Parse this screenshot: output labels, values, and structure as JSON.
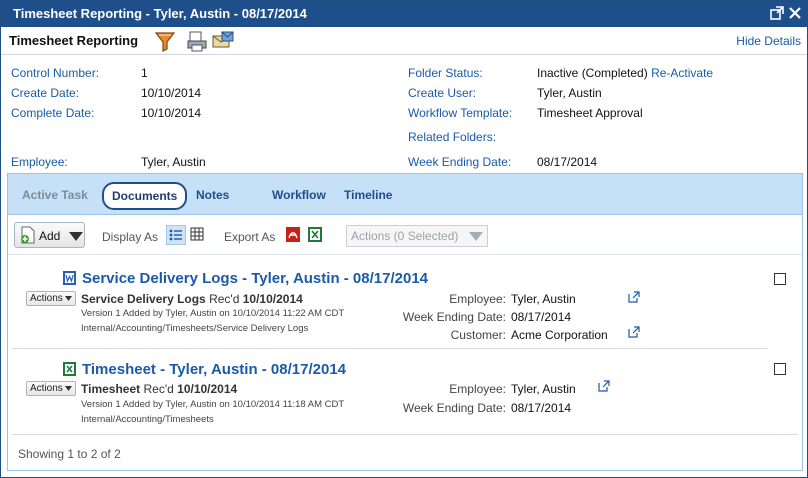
{
  "window": {
    "title": "Timesheet Reporting - Tyler, Austin - 08/17/2014"
  },
  "toolbar": {
    "title": "Timesheet Reporting",
    "hide_details": "Hide Details"
  },
  "details": {
    "control_number_label": "Control Number:",
    "control_number": "1",
    "create_date_label": "Create Date:",
    "create_date": "10/10/2014",
    "complete_date_label": "Complete Date:",
    "complete_date": "10/10/2014",
    "folder_status_label": "Folder Status:",
    "folder_status": "Inactive (Completed)",
    "reactivate": "Re-Activate",
    "create_user_label": "Create User:",
    "create_user": "Tyler, Austin",
    "workflow_template_label": "Workflow Template:",
    "workflow_template": "Timesheet Approval",
    "related_folders_label": "Related Folders:",
    "employee_label": "Employee:",
    "employee": "Tyler, Austin",
    "week_ending_label": "Week Ending Date:",
    "week_ending": "08/17/2014"
  },
  "tabs": {
    "active_task": "Active Task",
    "documents": "Documents",
    "notes": "Notes",
    "workflow": "Workflow",
    "timeline": "Timeline"
  },
  "docbar": {
    "add": "Add",
    "display_as": "Display As",
    "export_as": "Export As",
    "actions_selected": "Actions (0 Selected)"
  },
  "documents": [
    {
      "title": "Service Delivery Logs - Tyler, Austin - 08/17/2014",
      "actions": "Actions",
      "type": "Service Delivery Logs",
      "recd": "Rec'd",
      "recd_date": "10/10/2014",
      "version": "Version 1 Added by Tyler, Austin on 10/10/2014 11:22 AM CDT",
      "path": "Internal/Accounting/Timesheets/Service Delivery Logs",
      "employee_label": "Employee:",
      "employee": "Tyler, Austin",
      "week_label": "Week Ending Date:",
      "week": "08/17/2014",
      "customer_label": "Customer:",
      "customer": "Acme Corporation"
    },
    {
      "title": "Timesheet - Tyler, Austin - 08/17/2014",
      "actions": "Actions",
      "type": "Timesheet",
      "recd": "Rec'd",
      "recd_date": "10/10/2014",
      "version": "Version 1 Added by Tyler, Austin on 10/10/2014 11:18 AM CDT",
      "path": "Internal/Accounting/Timesheets",
      "employee_label": "Employee:",
      "employee": "Tyler, Austin",
      "week_label": "Week Ending Date:",
      "week": "08/17/2014"
    }
  ],
  "footer": {
    "showing": "Showing 1 to 2 of 2"
  },
  "colors": {
    "titlebar": "#1f4f8a",
    "link": "#1a5aa8",
    "tab_bar": "#c6e0f7"
  }
}
